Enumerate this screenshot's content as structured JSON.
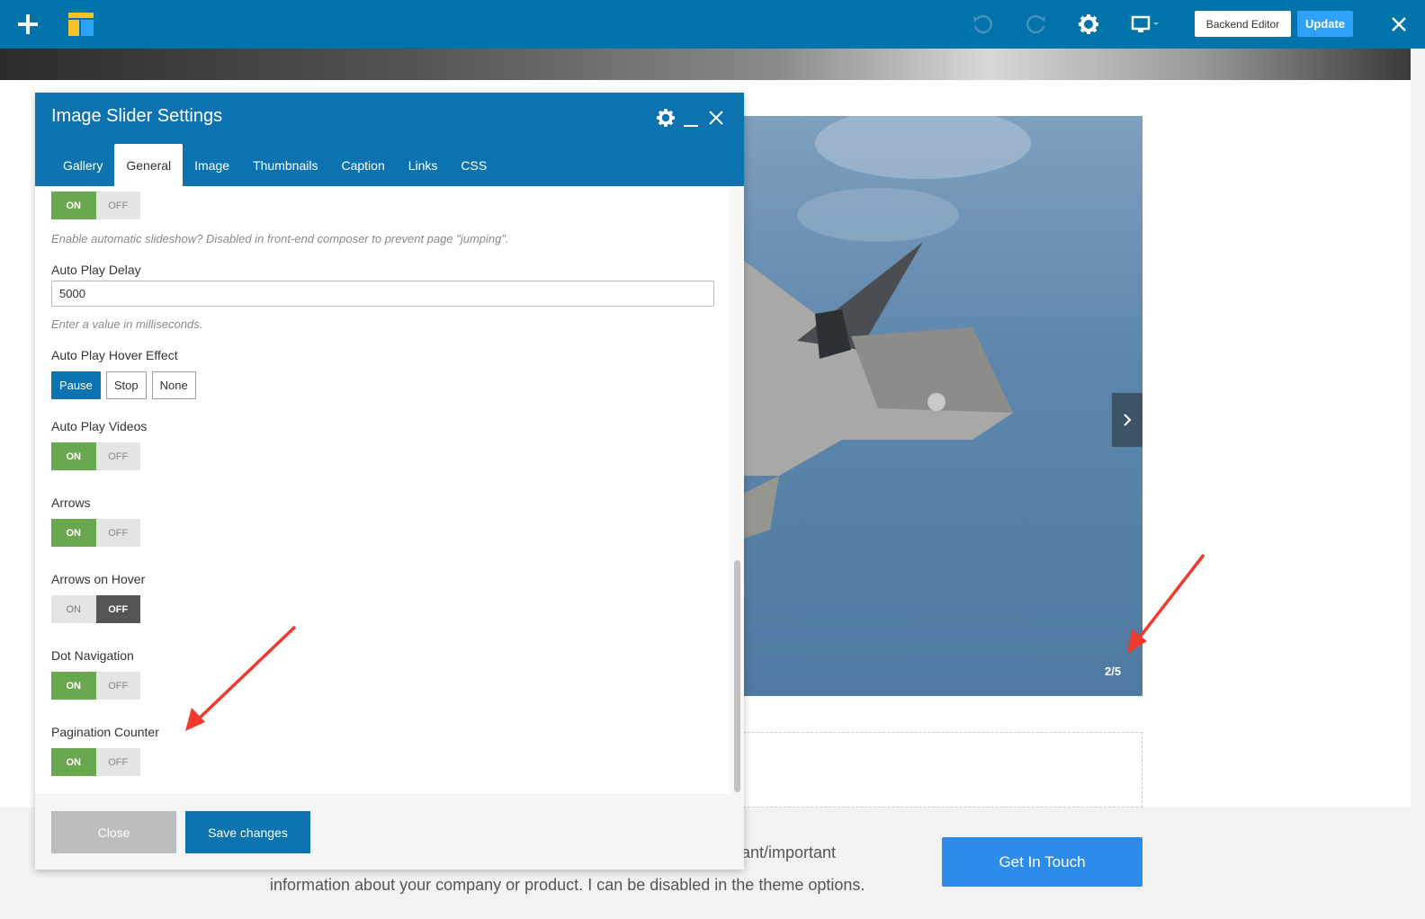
{
  "toolbar": {
    "add_icon": "plus-icon",
    "logo_icon": "logo-icon",
    "undo_icon": "undo-icon",
    "redo_icon": "redo-icon",
    "settings_icon": "gear-icon",
    "responsive_icon": "monitor-icon",
    "backend_editor_label": "Backend Editor",
    "update_label": "Update",
    "close_icon": "close-icon",
    "primary_color": "#0073aa",
    "update_color": "#2ea2f8"
  },
  "panel": {
    "title": "Image Slider Settings",
    "tabs": [
      {
        "label": "Gallery",
        "active": false
      },
      {
        "label": "General",
        "active": true
      },
      {
        "label": "Image",
        "active": false
      },
      {
        "label": "Thumbnails",
        "active": false
      },
      {
        "label": "Caption",
        "active": false
      },
      {
        "label": "Links",
        "active": false
      },
      {
        "label": "CSS",
        "active": false
      }
    ],
    "fields": {
      "auto_play": {
        "on": "ON",
        "off": "OFF",
        "value": true,
        "help": "Enable automatic slideshow? Disabled in front-end composer to prevent page \"jumping\"."
      },
      "auto_play_delay": {
        "label": "Auto Play Delay",
        "value": "5000",
        "help": "Enter a value in milliseconds."
      },
      "auto_play_hover": {
        "label": "Auto Play Hover Effect",
        "options": [
          "Pause",
          "Stop",
          "None"
        ],
        "selected": "Pause"
      },
      "auto_play_videos": {
        "label": "Auto Play Videos",
        "on": "ON",
        "off": "OFF",
        "value": true
      },
      "arrows": {
        "label": "Arrows",
        "on": "ON",
        "off": "OFF",
        "value": true
      },
      "arrows_on_hover": {
        "label": "Arrows on Hover",
        "on": "ON",
        "off": "OFF",
        "value": false
      },
      "dot_navigation": {
        "label": "Dot Navigation",
        "on": "ON",
        "off": "OFF",
        "value": true
      },
      "pagination_counter": {
        "label": "Pagination Counter",
        "on": "ON",
        "off": "OFF",
        "value": true
      }
    },
    "footer": {
      "close_label": "Close",
      "save_label": "Save changes"
    },
    "accent_color": "#0d72b0",
    "toggle_on_color": "#6aa84f"
  },
  "slider": {
    "counter": "2/5",
    "next_icon": "chevron-right-icon"
  },
  "cta": {
    "line1": "vant/important",
    "line2": "information about your company or product. I can be disabled in the theme options.",
    "button_label": "Get In Touch",
    "button_color": "#2d8cea"
  }
}
